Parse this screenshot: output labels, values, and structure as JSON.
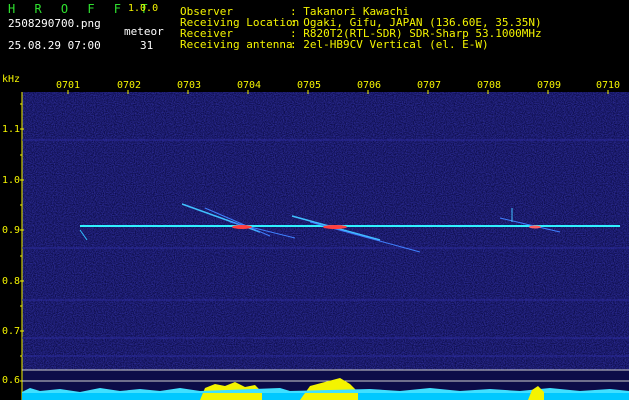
{
  "app": {
    "name": "H R O F F T",
    "version": "1.0.0"
  },
  "file": {
    "name": "2508290700.png",
    "datetime": "25.08.29 07:00"
  },
  "meteor": {
    "label": "meteor",
    "count": "31"
  },
  "info": [
    {
      "key": "Observer",
      "value": ": Takanori Kawachi"
    },
    {
      "key": "Receiving Location",
      "value": ": Ogaki, Gifu, JAPAN (136.60E, 35.35N)"
    },
    {
      "key": "Receiver",
      "value": ": R820T2(RTL-SDR) SDR-Sharp 53.1000MHz"
    },
    {
      "key": "Receiving antenna",
      "value": ": 2el-HB9CV Vertical (el. E-W)"
    }
  ],
  "axis": {
    "y_unit": "kHz",
    "y_ticks": [
      "1.1",
      "1.0",
      "0.9",
      "0.8",
      "0.7",
      "0.6"
    ],
    "x_ticks": [
      "0701",
      "0702",
      "0703",
      "0704",
      "0705",
      "0706",
      "0707",
      "0708",
      "0709",
      "0710"
    ]
  },
  "colors": {
    "background": "#000000",
    "text": "#f4f400",
    "logo": "#2fe02f",
    "plot_bg": "#101060",
    "carrier": "#30f0ff",
    "meteor": "#ff4040"
  }
}
